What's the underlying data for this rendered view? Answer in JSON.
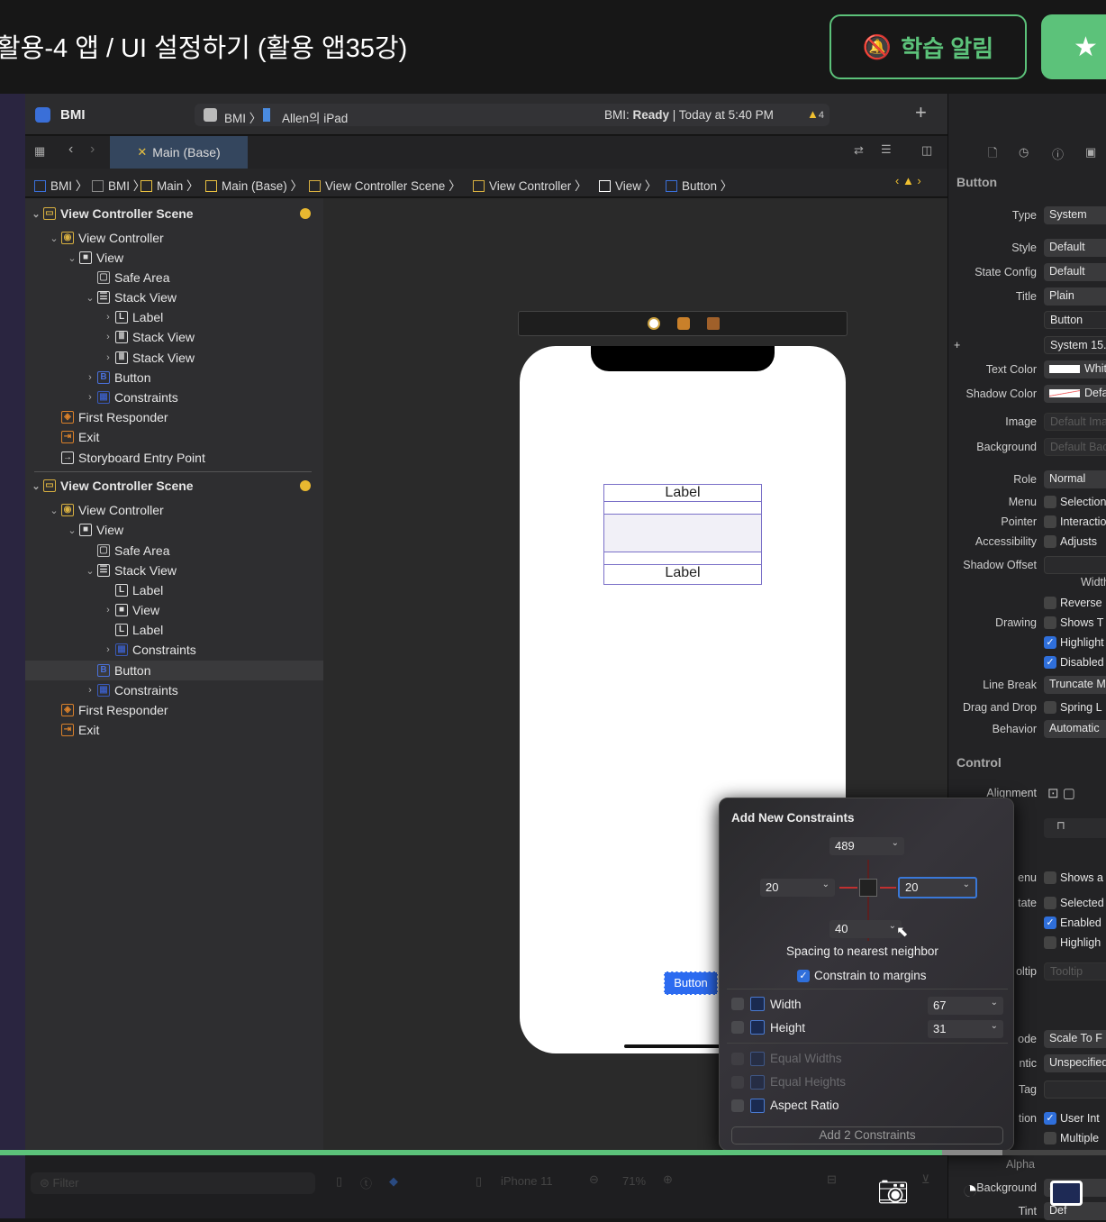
{
  "course": {
    "title": "활용-4 앱 / UI 설정하기 (활용 앱35강)",
    "notify_label": "학습 알림",
    "notify_icon": "bell-slash-icon",
    "star_icon": "star-icon",
    "accent": "#5cc27a"
  },
  "xcode": {
    "project": "BMI",
    "scheme": "BMI",
    "device": "Allen의 iPad",
    "status_prefix": "BMI: ",
    "status_state": "Ready",
    "status_time": " | Today at 5:40 PM",
    "warnings": "4",
    "tab": "Main (Base)",
    "jump": [
      "BMI",
      "BMI",
      "Main",
      "Main (Base)",
      "View Controller Scene",
      "View Controller",
      "View",
      "Button"
    ]
  },
  "outline": [
    {
      "label": "View Controller Scene",
      "depth": 0,
      "icon": "scene",
      "open": true,
      "badge": true
    },
    {
      "label": "View Controller",
      "depth": 1,
      "icon": "vc",
      "open": true
    },
    {
      "label": "View",
      "depth": 2,
      "icon": "view",
      "open": true
    },
    {
      "label": "Safe Area",
      "depth": 3,
      "icon": "safe"
    },
    {
      "label": "Stack View",
      "depth": 3,
      "icon": "vstack",
      "open": true
    },
    {
      "label": "Label",
      "depth": 4,
      "icon": "L",
      "closed": true
    },
    {
      "label": "Stack View",
      "depth": 4,
      "icon": "hstack",
      "closed": true
    },
    {
      "label": "Stack View",
      "depth": 4,
      "icon": "hstack",
      "closed": true
    },
    {
      "label": "Button",
      "depth": 3,
      "icon": "B",
      "closed": true
    },
    {
      "label": "Constraints",
      "depth": 3,
      "icon": "cons",
      "closed": true
    },
    {
      "label": "First Responder",
      "depth": 1,
      "icon": "fr"
    },
    {
      "label": "Exit",
      "depth": 1,
      "icon": "exit"
    },
    {
      "label": "Storyboard Entry Point",
      "depth": 1,
      "icon": "arrow"
    },
    {
      "label": "View Controller Scene",
      "depth": 0,
      "icon": "scene",
      "open": true,
      "badge": true
    },
    {
      "label": "View Controller",
      "depth": 1,
      "icon": "vc",
      "open": true
    },
    {
      "label": "View",
      "depth": 2,
      "icon": "view",
      "open": true
    },
    {
      "label": "Safe Area",
      "depth": 3,
      "icon": "safe"
    },
    {
      "label": "Stack View",
      "depth": 3,
      "icon": "vstack",
      "open": true
    },
    {
      "label": "Label",
      "depth": 4,
      "icon": "L"
    },
    {
      "label": "View",
      "depth": 4,
      "icon": "view",
      "closed": true
    },
    {
      "label": "Label",
      "depth": 4,
      "icon": "L"
    },
    {
      "label": "Constraints",
      "depth": 4,
      "icon": "cons",
      "closed": true
    },
    {
      "label": "Button",
      "depth": 3,
      "icon": "B",
      "selected": true
    },
    {
      "label": "Constraints",
      "depth": 3,
      "icon": "cons",
      "closed": true
    },
    {
      "label": "First Responder",
      "depth": 1,
      "icon": "fr"
    },
    {
      "label": "Exit",
      "depth": 1,
      "icon": "exit"
    }
  ],
  "canvas": {
    "labels": [
      "Label",
      "Label"
    ],
    "button": "Button"
  },
  "inspector": {
    "section": "Button",
    "control_section": "Control",
    "rows": [
      {
        "label": "Type",
        "value": "System",
        "kind": "popup"
      },
      {
        "label": "Style",
        "value": "Default",
        "kind": "popup"
      },
      {
        "label": "State Config",
        "value": "Default",
        "kind": "popup"
      },
      {
        "label": "Title",
        "value": "Plain",
        "kind": "popup"
      },
      {
        "label": "",
        "value": "Button",
        "kind": "field"
      },
      {
        "label": "+",
        "value": "System 15.",
        "kind": "field"
      },
      {
        "label": "Text Color",
        "value": "White",
        "kind": "color"
      },
      {
        "label": "Shadow Color",
        "value": "Default",
        "kind": "color"
      },
      {
        "label": "Image",
        "value": "Default Image",
        "kind": "placeholder"
      },
      {
        "label": "Background",
        "value": "Default Background",
        "kind": "placeholder"
      },
      {
        "label": "Role",
        "value": "Normal",
        "kind": "popup"
      },
      {
        "label": "Menu",
        "value": "Selection",
        "kind": "check",
        "checked": false
      },
      {
        "label": "Pointer",
        "value": "Interaction",
        "kind": "check",
        "checked": false
      },
      {
        "label": "Accessibility",
        "value": "Adjusts",
        "kind": "check",
        "checked": false
      },
      {
        "label": "Shadow Offset",
        "value": "",
        "kind": "field"
      },
      {
        "label": "",
        "value": "Width",
        "kind": "sub"
      },
      {
        "label": "",
        "value": "Reverse",
        "kind": "check",
        "checked": false
      },
      {
        "label": "Drawing",
        "value": "Shows T",
        "kind": "check",
        "checked": false
      },
      {
        "label": "",
        "value": "Highlight",
        "kind": "check",
        "checked": true
      },
      {
        "label": "",
        "value": "Disabled",
        "kind": "check",
        "checked": true
      },
      {
        "label": "Line Break",
        "value": "Truncate M",
        "kind": "popup"
      },
      {
        "label": "Drag and Drop",
        "value": "Spring L",
        "kind": "check",
        "checked": false
      },
      {
        "label": "Behavior",
        "value": "Automatic",
        "kind": "popup"
      },
      {
        "label": "Alignment",
        "value": "",
        "kind": "align"
      },
      {
        "label": "",
        "value": "",
        "kind": "align2"
      },
      {
        "label": "enu",
        "value": "Shows a",
        "kind": "check",
        "checked": false
      },
      {
        "label": "tate",
        "value": "Selected",
        "kind": "check",
        "checked": false
      },
      {
        "label": "",
        "value": "Enabled",
        "kind": "check",
        "checked": true
      },
      {
        "label": "",
        "value": "Highligh",
        "kind": "check",
        "checked": false
      },
      {
        "label": "oltip",
        "value": "Tooltip",
        "kind": "placeholder"
      },
      {
        "label": "ode",
        "value": "Scale To F",
        "kind": "popup"
      },
      {
        "label": "ntic",
        "value": "Unspecified",
        "kind": "popup"
      },
      {
        "label": "Tag",
        "value": "",
        "kind": "field"
      },
      {
        "label": "tion",
        "value": "User Int",
        "kind": "check",
        "checked": true
      },
      {
        "label": "",
        "value": "Multiple",
        "kind": "check",
        "checked": false
      },
      {
        "label": "Alpha",
        "value": "",
        "kind": "sub2"
      },
      {
        "label": "Background",
        "value": "Sys",
        "kind": "popup"
      },
      {
        "label": "Tint",
        "value": "Def",
        "kind": "popup"
      }
    ]
  },
  "popup": {
    "title": "Add New Constraints",
    "top": "489",
    "left": "20",
    "right": "20",
    "bottom": "40",
    "spacing_label": "Spacing to nearest neighbor",
    "margins_label": "Constrain to margins",
    "margins_checked": true,
    "width_label": "Width",
    "width_value": "67",
    "height_label": "Height",
    "height_value": "31",
    "equal_widths": "Equal Widths",
    "equal_heights": "Equal Heights",
    "aspect": "Aspect Ratio",
    "add_button": "Add 2 Constraints"
  },
  "bottom": {
    "filter_placeholder": "Filter",
    "device": "iPhone 11",
    "zoom": "71%"
  },
  "video": {
    "progress": 0.852,
    "buffered": 0.906,
    "icons": [
      "camera-icon",
      "speed-icon",
      "subtitles-icon"
    ]
  }
}
